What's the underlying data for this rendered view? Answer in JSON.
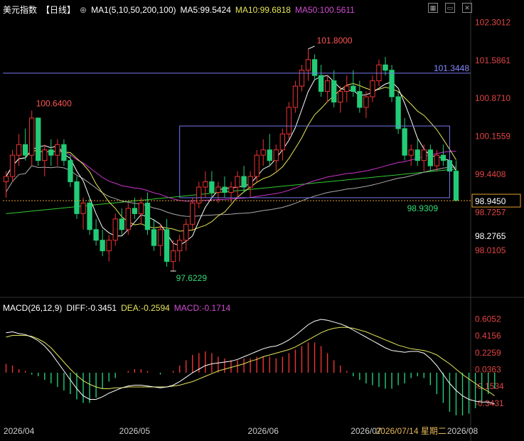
{
  "header": {
    "instrument": "美元指数",
    "period": "【日线】",
    "ma_label": "MA1(5,10,50,200,100)",
    "ma5": "MA5:99.5424",
    "ma10": "MA10:99.6818",
    "ma50": "MA50:100.5611",
    "icons": [
      "grid-icon",
      "panel-icon",
      "close-icon"
    ]
  },
  "macd_header": {
    "label": "MACD(26,12,9)",
    "diff": "DIFF:-0.3451",
    "dea": "DEA:-0.2594",
    "macd": "MACD:-0.1714"
  },
  "colors": {
    "up": "#ee3333",
    "down": "#22cc77",
    "ma5": "#ffffff",
    "ma10": "#e6e65a",
    "ma50": "#cc33cc",
    "ma100": "#aaaaaa",
    "ma200": "#33cc33",
    "text_yellow": "#e6e65a",
    "text_magenta": "#cc44cc"
  },
  "annotations": {
    "high": "101.8000",
    "left_peak": "100.6400",
    "low": "97.6229",
    "box_low": "98.9309",
    "h_line": "101.3448",
    "current": "98.9450",
    "prev": "98.2765"
  },
  "price_axis": [
    "102.3012",
    "101.5861",
    "100.8710",
    "100.1559",
    "99.4408",
    "98.7257",
    "98.0105"
  ],
  "macd_axis": [
    "0.6052",
    "0.4156",
    "0.2259",
    "0.0363",
    "-0.1534",
    "-0.3431"
  ],
  "date_axis": [
    "2026/04",
    "2026/05",
    "2026/06",
    "2026/07",
    "2026/07/14 星期二",
    "2026/08"
  ],
  "chart_data": {
    "type": "candlestick",
    "ylim": [
      97.5,
      102.4
    ],
    "candles": [
      [
        99.3,
        99.5,
        99.0,
        99.4
      ],
      [
        99.4,
        99.9,
        99.3,
        99.8
      ],
      [
        99.8,
        100.2,
        99.6,
        100.0
      ],
      [
        100.0,
        100.3,
        99.7,
        99.8
      ],
      [
        99.8,
        100.64,
        99.6,
        100.5
      ],
      [
        100.5,
        100.5,
        99.6,
        99.7
      ],
      [
        99.7,
        100.0,
        99.4,
        99.9
      ],
      [
        99.9,
        100.1,
        99.6,
        99.8
      ],
      [
        99.8,
        100.1,
        99.6,
        100.0
      ],
      [
        100.0,
        100.1,
        99.6,
        99.7
      ],
      [
        99.7,
        99.8,
        99.2,
        99.3
      ],
      [
        99.3,
        99.4,
        98.6,
        98.7
      ],
      [
        98.7,
        99.0,
        98.4,
        98.9
      ],
      [
        98.9,
        99.0,
        98.3,
        98.4
      ],
      [
        98.4,
        98.6,
        98.1,
        98.2
      ],
      [
        98.2,
        98.4,
        97.9,
        98.0
      ],
      [
        98.0,
        98.3,
        97.8,
        98.2
      ],
      [
        98.2,
        98.7,
        98.1,
        98.6
      ],
      [
        98.6,
        98.8,
        98.3,
        98.4
      ],
      [
        98.4,
        98.9,
        98.3,
        98.8
      ],
      [
        98.8,
        99.0,
        98.6,
        98.7
      ],
      [
        98.7,
        99.0,
        98.5,
        98.9
      ],
      [
        98.9,
        99.1,
        98.3,
        98.4
      ],
      [
        98.4,
        98.6,
        98.0,
        98.1
      ],
      [
        98.1,
        98.5,
        97.9,
        98.4
      ],
      [
        98.4,
        98.6,
        97.7,
        97.8
      ],
      [
        97.8,
        98.2,
        97.62,
        98.0
      ],
      [
        98.0,
        98.3,
        97.8,
        98.2
      ],
      [
        98.2,
        98.6,
        98.0,
        98.5
      ],
      [
        98.5,
        99.0,
        98.4,
        98.9
      ],
      [
        98.9,
        99.3,
        98.8,
        99.2
      ],
      [
        99.2,
        99.5,
        99.0,
        99.3
      ],
      [
        99.3,
        99.5,
        99.0,
        99.1
      ],
      [
        99.1,
        99.3,
        98.9,
        99.2
      ],
      [
        99.2,
        99.4,
        99.0,
        99.1
      ],
      [
        99.1,
        99.3,
        98.9,
        99.2
      ],
      [
        99.2,
        99.5,
        99.0,
        99.4
      ],
      [
        99.4,
        99.6,
        99.1,
        99.2
      ],
      [
        99.2,
        99.5,
        99.0,
        99.4
      ],
      [
        99.4,
        99.9,
        99.3,
        99.8
      ],
      [
        99.8,
        100.1,
        99.6,
        99.9
      ],
      [
        99.9,
        100.2,
        99.6,
        99.7
      ],
      [
        99.7,
        100.0,
        99.5,
        99.9
      ],
      [
        99.9,
        100.3,
        99.7,
        100.2
      ],
      [
        100.2,
        100.8,
        100.1,
        100.7
      ],
      [
        100.7,
        101.2,
        100.6,
        101.1
      ],
      [
        101.1,
        101.5,
        101.0,
        101.4
      ],
      [
        101.4,
        101.8,
        101.2,
        101.6
      ],
      [
        101.6,
        101.7,
        101.2,
        101.3
      ],
      [
        101.3,
        101.5,
        100.9,
        101.0
      ],
      [
        101.0,
        101.3,
        100.8,
        101.2
      ],
      [
        101.2,
        101.4,
        100.7,
        100.8
      ],
      [
        100.8,
        101.1,
        100.6,
        101.0
      ],
      [
        101.0,
        101.3,
        100.8,
        101.1
      ],
      [
        101.1,
        101.4,
        100.9,
        101.0
      ],
      [
        101.0,
        101.2,
        100.6,
        100.7
      ],
      [
        100.7,
        101.0,
        100.5,
        100.9
      ],
      [
        100.9,
        101.3,
        100.8,
        101.2
      ],
      [
        101.2,
        101.6,
        101.1,
        101.5
      ],
      [
        101.5,
        101.65,
        101.3,
        101.4
      ],
      [
        101.4,
        101.5,
        100.8,
        100.9
      ],
      [
        100.9,
        101.0,
        100.2,
        100.3
      ],
      [
        100.3,
        100.5,
        99.7,
        99.8
      ],
      [
        99.8,
        100.0,
        99.6,
        99.9
      ],
      [
        99.9,
        100.1,
        99.6,
        99.7
      ],
      [
        99.7,
        100.0,
        99.5,
        99.9
      ],
      [
        99.9,
        100.0,
        99.5,
        99.6
      ],
      [
        99.6,
        99.9,
        99.5,
        99.8
      ],
      [
        99.8,
        100.0,
        99.6,
        99.7
      ],
      [
        99.7,
        99.9,
        99.4,
        99.5
      ],
      [
        99.5,
        99.7,
        98.93,
        98.95
      ]
    ],
    "macd": {
      "diff": [
        0.45,
        0.46,
        0.44,
        0.43,
        0.4,
        0.36,
        0.3,
        0.22,
        0.12,
        0.02,
        -0.08,
        -0.18,
        -0.26,
        -0.3,
        -0.3,
        -0.27,
        -0.23,
        -0.2,
        -0.17,
        -0.15,
        -0.14,
        -0.14,
        -0.15,
        -0.16,
        -0.17,
        -0.16,
        -0.14,
        -0.1,
        -0.05,
        0.0,
        0.04,
        0.08,
        0.1,
        0.11,
        0.12,
        0.13,
        0.15,
        0.18,
        0.21,
        0.24,
        0.27,
        0.29,
        0.3,
        0.33,
        0.37,
        0.42,
        0.48,
        0.54,
        0.58,
        0.6,
        0.59,
        0.57,
        0.55,
        0.52,
        0.48,
        0.44,
        0.4,
        0.36,
        0.32,
        0.28,
        0.25,
        0.24,
        0.23,
        0.24,
        0.24,
        0.22,
        0.16,
        0.08,
        -0.02,
        -0.12,
        -0.2,
        -0.26,
        -0.3,
        -0.32,
        -0.33,
        -0.33,
        -0.35
      ],
      "dea": [
        0.4,
        0.42,
        0.42,
        0.42,
        0.41,
        0.38,
        0.34,
        0.28,
        0.2,
        0.12,
        0.04,
        -0.03,
        -0.09,
        -0.13,
        -0.16,
        -0.18,
        -0.18,
        -0.17,
        -0.17,
        -0.16,
        -0.16,
        -0.16,
        -0.16,
        -0.16,
        -0.16,
        -0.16,
        -0.15,
        -0.14,
        -0.12,
        -0.1,
        -0.07,
        -0.04,
        -0.01,
        0.02,
        0.04,
        0.06,
        0.08,
        0.1,
        0.13,
        0.15,
        0.18,
        0.2,
        0.22,
        0.24,
        0.26,
        0.29,
        0.33,
        0.37,
        0.41,
        0.45,
        0.48,
        0.5,
        0.51,
        0.51,
        0.5,
        0.48,
        0.46,
        0.43,
        0.4,
        0.37,
        0.34,
        0.31,
        0.29,
        0.27,
        0.26,
        0.25,
        0.23,
        0.2,
        0.15,
        0.1,
        0.04,
        -0.02,
        -0.07,
        -0.12,
        -0.17,
        -0.21,
        -0.26
      ]
    }
  }
}
